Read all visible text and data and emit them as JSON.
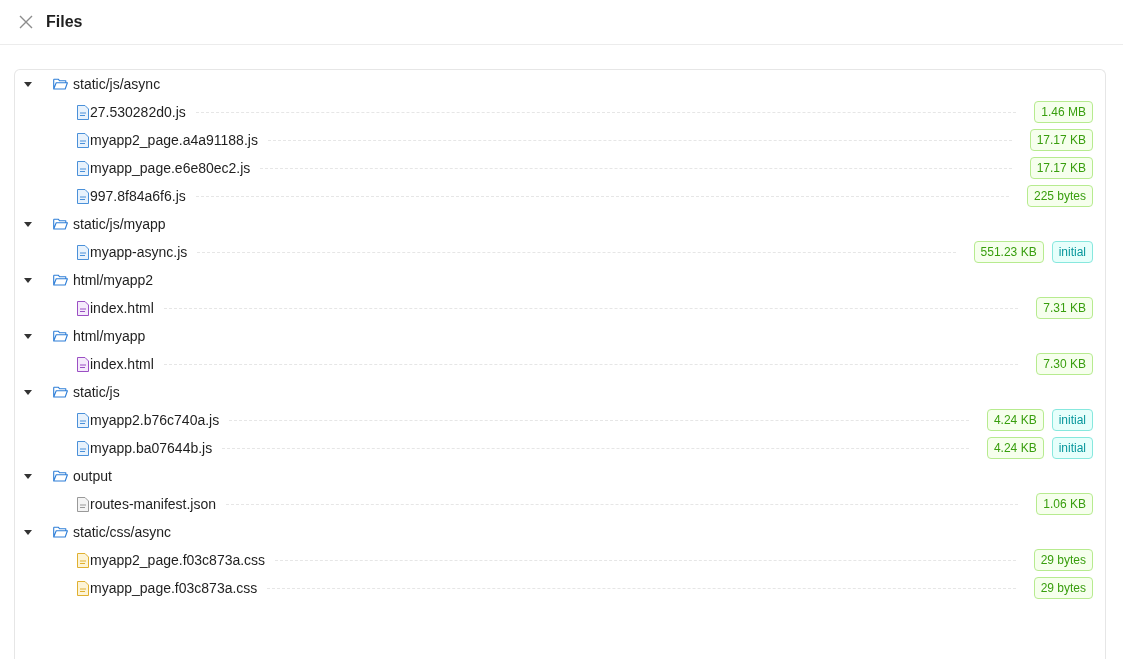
{
  "header": {
    "title": "Files"
  },
  "folders": [
    {
      "name": "static/js/async",
      "expanded": true,
      "children": [
        {
          "name": "27.530282d0.js",
          "kind": "js",
          "size": "1.46 MB"
        },
        {
          "name": "myapp2_page.a4a91188.js",
          "kind": "js",
          "size": "17.17 KB"
        },
        {
          "name": "myapp_page.e6e80ec2.js",
          "kind": "js",
          "size": "17.17 KB"
        },
        {
          "name": "997.8f84a6f6.js",
          "kind": "js",
          "size": "225 bytes"
        }
      ]
    },
    {
      "name": "static/js/myapp",
      "expanded": true,
      "children": [
        {
          "name": "myapp-async.js",
          "kind": "js",
          "size": "551.23 KB",
          "tag": "initial"
        }
      ]
    },
    {
      "name": "html/myapp2",
      "expanded": true,
      "children": [
        {
          "name": "index.html",
          "kind": "html",
          "size": "7.31 KB"
        }
      ]
    },
    {
      "name": "html/myapp",
      "expanded": true,
      "children": [
        {
          "name": "index.html",
          "kind": "html",
          "size": "7.30 KB"
        }
      ]
    },
    {
      "name": "static/js",
      "expanded": true,
      "children": [
        {
          "name": "myapp2.b76c740a.js",
          "kind": "js",
          "size": "4.24 KB",
          "tag": "initial"
        },
        {
          "name": "myapp.ba07644b.js",
          "kind": "js",
          "size": "4.24 KB",
          "tag": "initial"
        }
      ]
    },
    {
      "name": "output",
      "expanded": true,
      "children": [
        {
          "name": "routes-manifest.json",
          "kind": "json",
          "size": "1.06 KB"
        }
      ]
    },
    {
      "name": "static/css/async",
      "expanded": true,
      "children": [
        {
          "name": "myapp2_page.f03c873a.css",
          "kind": "css",
          "size": "29 bytes"
        },
        {
          "name": "myapp_page.f03c873a.css",
          "kind": "css",
          "size": "29 bytes"
        }
      ]
    }
  ]
}
